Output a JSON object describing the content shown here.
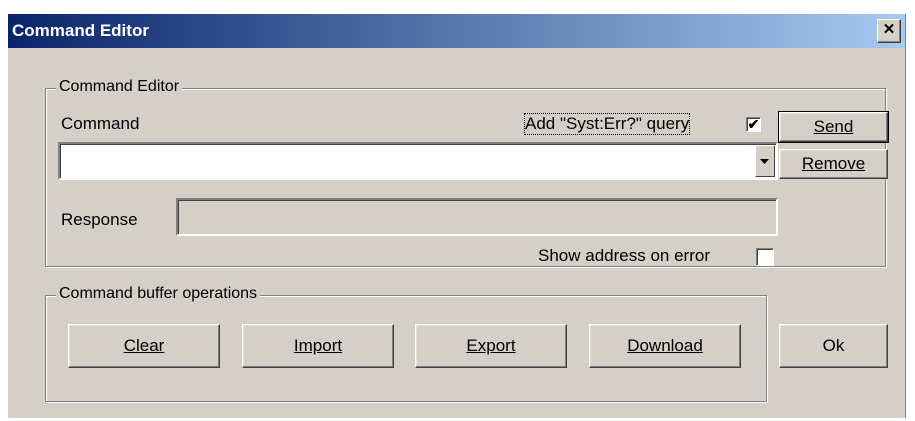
{
  "window": {
    "title": "Command Editor",
    "close_glyph": "✕"
  },
  "editor_group": {
    "label": "Command Editor",
    "command_label": "Command",
    "syst_err_label": "Add \"Syst:Err?\" query",
    "syst_err_checked": true,
    "command_value": "",
    "send_label": "Send",
    "remove_label": "Remove",
    "response_label": "Response",
    "response_value": "",
    "show_address_label": "Show address on error",
    "show_address_checked": false
  },
  "buffer_group": {
    "label": "Command buffer operations",
    "clear_label": "Clear",
    "import_label": "Import",
    "export_label": "Export",
    "download_label": "Download"
  },
  "ok_label": "Ok",
  "icons": {
    "dropdown": "chevron-down-icon",
    "check": "checkmark-icon"
  }
}
